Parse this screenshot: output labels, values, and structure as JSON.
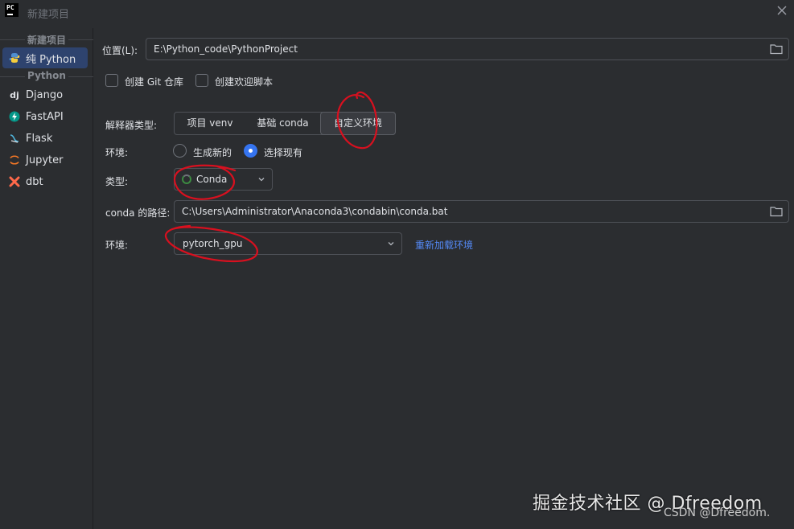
{
  "window": {
    "title": "新建项目",
    "logo_text": "PC"
  },
  "sidebar": {
    "group_new": "新建项目",
    "item_pure_python": "纯 Python",
    "group_python": "Python",
    "items": [
      {
        "label": "Django",
        "icon": "django-icon"
      },
      {
        "label": "FastAPI",
        "icon": "fastapi-icon"
      },
      {
        "label": "Flask",
        "icon": "flask-icon"
      },
      {
        "label": "Jupyter",
        "icon": "jupyter-icon"
      },
      {
        "label": "dbt",
        "icon": "dbt-icon"
      }
    ]
  },
  "form": {
    "location_label": "位置(L):",
    "location_value": "E:\\Python_code\\PythonProject",
    "create_git_label": "创建 Git 仓库",
    "create_welcome_label": "创建欢迎脚本",
    "interpreter_type_label": "解释器类型:",
    "interpreter_tabs": [
      "项目 venv",
      "基础 conda",
      "自定义环境"
    ],
    "env_label": "环境:",
    "env_radio_new": "生成新的",
    "env_radio_existing": "选择现有",
    "type_label": "类型:",
    "type_value": "Conda",
    "conda_path_label": "conda 的路径:",
    "conda_path_value": "C:\\Users\\Administrator\\Anaconda3\\condabin\\conda.bat",
    "env2_label": "环境:",
    "env2_value": "pytorch_gpu",
    "reload_link": "重新加载环境"
  },
  "watermark": {
    "line1": "掘金技术社区 @ Dfreedom",
    "line2": "CSDN @Dfreedom."
  },
  "colors": {
    "accent": "#3574f0",
    "link": "#548af7",
    "selected_bg": "#2e436e",
    "annotation": "#d8101f"
  }
}
